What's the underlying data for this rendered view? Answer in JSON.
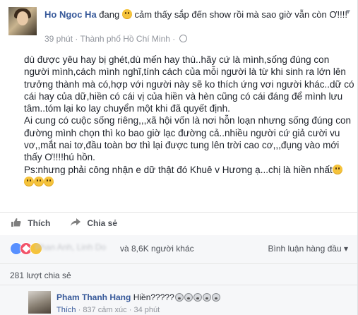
{
  "post": {
    "author": "Ho Ngoc Ha",
    "feeling_prefix": "đang",
    "feeling_text": "cảm thấy sắp đến show rồi mà sao giờ vẫn còn Ơ!!!!",
    "time": "39 phút",
    "separator": "·",
    "location": "Thành phố Hồ Chí Minh",
    "paragraph_1": "dù được yêu hay bị ghét,dù mến hay thù..hãy cứ là mình,sống đúng con người mình,cách mình nghĩ,tính cách của mỗi người là từ khi sinh ra lớn lên trưởng thành mà có,hợp với người này sẽ ko thích ứng vơi người khác..dữ có cái hay của dữ,hiền có cái vị của hiền và hèn cũng có cái đáng để mình lưu tâm..tóm lại ko lay chuyển một khi đã quyết định.",
    "paragraph_2": "Ai cung có cuộc sống riêng,,,xã hội vốn là nơi hỗn loạn nhưng sống đúng con đường mình chọn thì ko bao giờ lạc đường cả..nhiều người cứ giả cười vu vơ,,mắt nai tơ,đầu toàn bơ thì lại được tung lên trời cao cơ,,,đụng vào mới thấy Ơ!!!!hú hồn.",
    "paragraph_3": "Ps:nhưng phải công nhận e dữ thật đó Khuê v Hương ạ...chị là hiền nhất"
  },
  "actions": {
    "like_label": "Thích",
    "share_label": "Chia sẻ"
  },
  "reactions": {
    "blurred_names": "Phan Anh, Linh Do",
    "others_text": "và 8,6K người khác",
    "sort_label": "Bình luận hàng đầu",
    "sort_arrow": "▾"
  },
  "share_count": "281 lượt chia sẻ",
  "comment": {
    "author": "Pham Thanh Hang",
    "text": "Hiền?????",
    "like_label": "Thích",
    "separator": "·",
    "reaction_count": "837 cảm xúc",
    "time": "34 phút"
  },
  "icons": {
    "header_chevron": "chevron-down-icon",
    "globe": "globe-icon",
    "like": "thumbs-up-icon",
    "share": "share-arrow-icon"
  },
  "colors": {
    "link_blue": "#365899",
    "like_blue": "#5890ff",
    "love_red": "#f25268",
    "haha_yellow": "#f5c33b"
  }
}
